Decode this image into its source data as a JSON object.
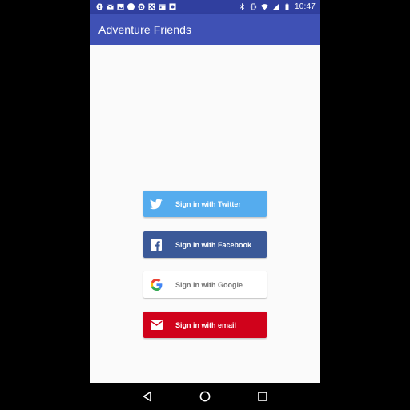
{
  "status_bar": {
    "time": "10:47",
    "left_icons": [
      "notification-icon",
      "gmail-icon",
      "image-icon",
      "circle-icon",
      "bitcoin-icon",
      "notification-mute-icon",
      "calendar-icon",
      "photo-icon"
    ],
    "right_icons": [
      "bluetooth-icon",
      "vibrate-icon",
      "wifi-icon",
      "signal-icon",
      "battery-icon"
    ]
  },
  "app_bar": {
    "title": "Adventure Friends",
    "color": "#3f51b5"
  },
  "auth": {
    "buttons": [
      {
        "label": "Sign in with Twitter",
        "icon": "twitter-icon",
        "color": "#55acee"
      },
      {
        "label": "Sign in with Facebook",
        "icon": "facebook-icon",
        "color": "#3b5998"
      },
      {
        "label": "Sign in with Google",
        "icon": "google-icon",
        "color": "#ffffff"
      },
      {
        "label": "Sign in with email",
        "icon": "email-icon",
        "color": "#d0021b"
      }
    ]
  },
  "nav_bar": {
    "buttons": [
      "back-icon",
      "home-icon",
      "recents-icon"
    ]
  }
}
